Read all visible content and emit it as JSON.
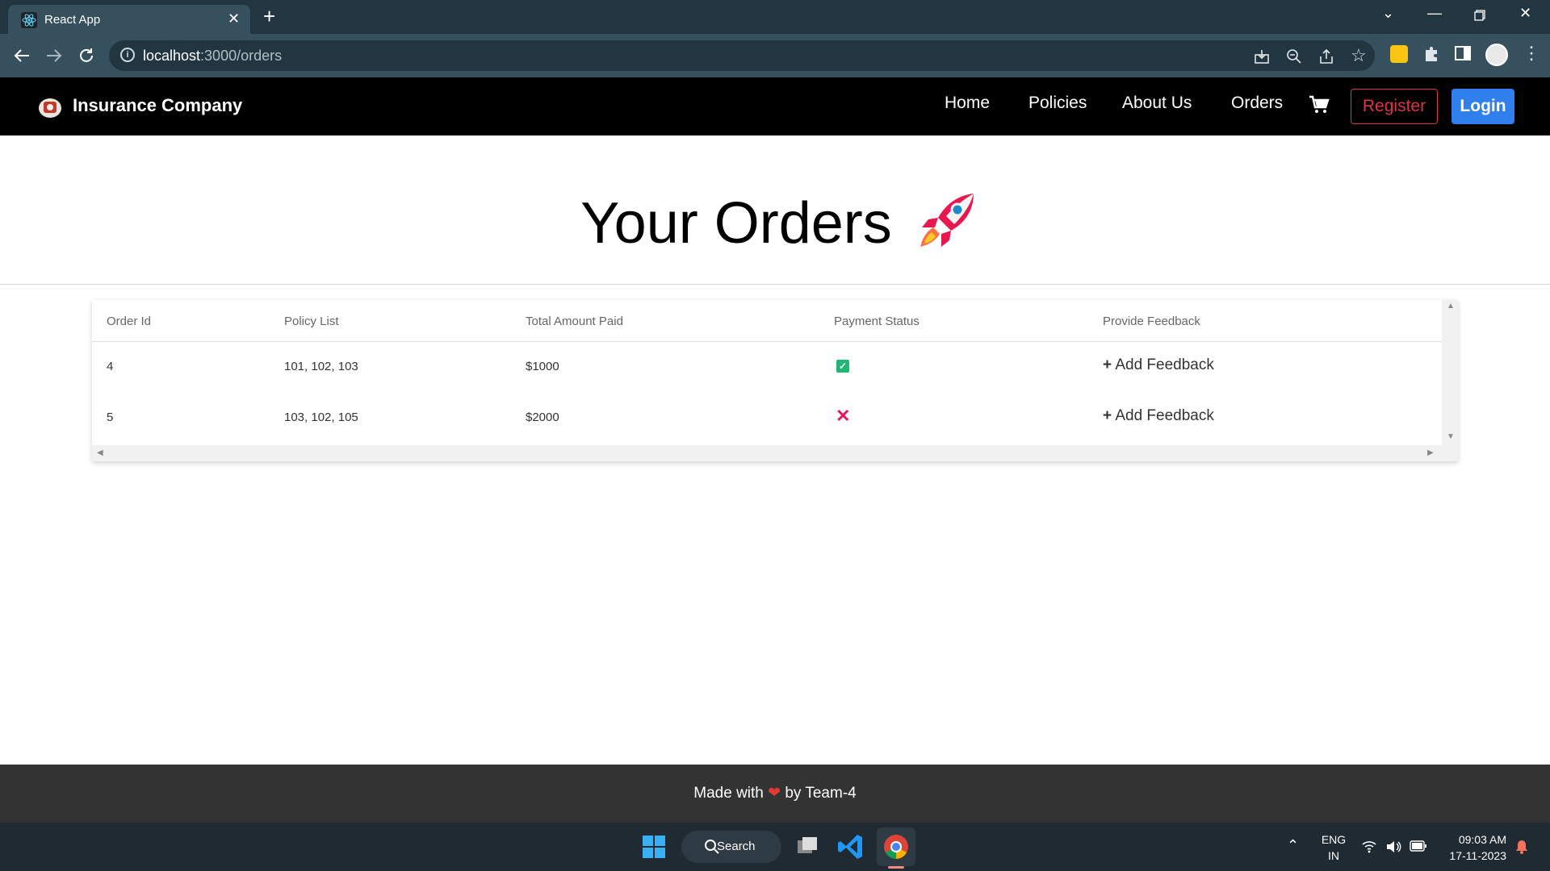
{
  "browser": {
    "tab_title": "React App",
    "tab_close": "✕",
    "new_tab": "+",
    "url_host": "localhost",
    "url_path": ":3000/orders",
    "info_glyph": "i",
    "icons": [
      "back-icon",
      "forward-icon",
      "reload-icon",
      "install-icon",
      "zoom-icon",
      "share-icon",
      "bookmark-star-icon",
      "extension-icon",
      "puzzle-icon",
      "side-panel-icon",
      "profile-avatar",
      "menu-icon"
    ]
  },
  "navbar": {
    "brand": "Insurance Company",
    "links": [
      "Home",
      "Policies",
      "About Us",
      "Orders"
    ],
    "register": "Register",
    "login": "Login"
  },
  "page": {
    "title": "Your Orders"
  },
  "table": {
    "headers": [
      "Order Id",
      "Policy List",
      "Total Amount Paid",
      "Payment Status",
      "Provide Feedback"
    ],
    "rows": [
      {
        "order_id": "4",
        "policies": "101, 102, 103",
        "amount": "$1000",
        "status": "paid",
        "feedback": "Add Feedback"
      },
      {
        "order_id": "5",
        "policies": "103, 102, 105",
        "amount": "$2000",
        "status": "unpaid",
        "feedback": "Add Feedback"
      }
    ]
  },
  "footer": {
    "made_with": "Made with",
    "by_team": "by Team-4"
  },
  "taskbar": {
    "search": "Search",
    "lang_line1": "ENG",
    "lang_line2": "IN",
    "time": "09:03 AM",
    "date": "17-11-2023"
  },
  "colors": {
    "accent_blue": "#2f80ed",
    "register_red": "#dc3545",
    "paid_green": "#22b573",
    "unpaid_red": "#e8175d"
  }
}
